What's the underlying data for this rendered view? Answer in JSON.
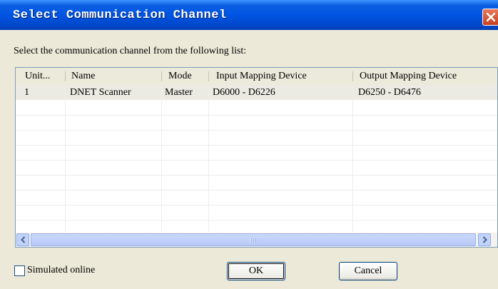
{
  "dialog": {
    "title": "Select Communication Channel",
    "instruction": "Select the communication channel from the following list:"
  },
  "table": {
    "columns": [
      "Unit...",
      "Name",
      "Mode",
      "Input Mapping Device",
      "Output Mapping Device"
    ],
    "rows": [
      {
        "unit": "1",
        "name": "DNET Scanner",
        "mode": "Master",
        "input": "D6000 - D6226",
        "output": "D6250 - D6476"
      }
    ]
  },
  "options": {
    "simulated_online_label": "Simulated online",
    "simulated_online_checked": false
  },
  "buttons": {
    "ok": "OK",
    "cancel": "Cancel"
  },
  "colors": {
    "titlebar": "#0054e3",
    "dialog_bg": "#ece9d8",
    "close": "#c8401f"
  }
}
